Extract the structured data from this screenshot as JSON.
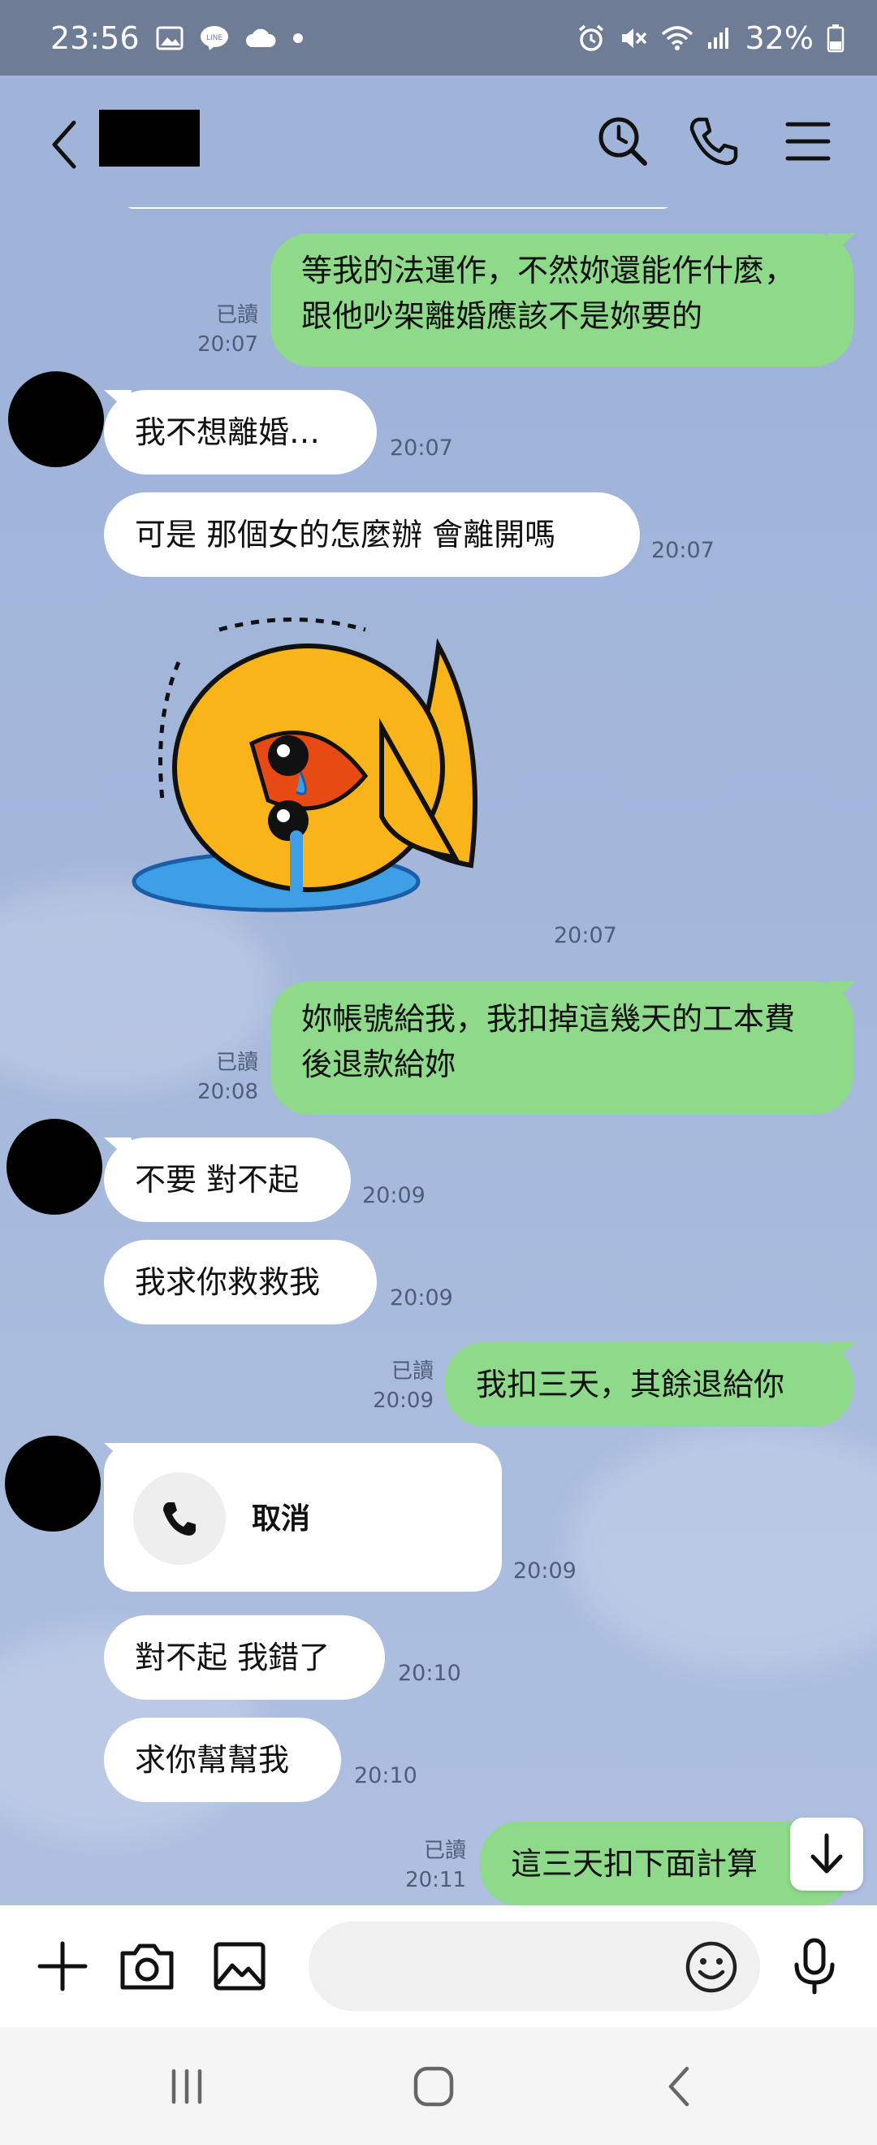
{
  "status_bar": {
    "time": "23:56",
    "battery": "32%"
  },
  "header": {
    "contact_name": "(redacted)"
  },
  "messages": {
    "m1": {
      "text": "等我的法運作，不然妳還能作什麼，跟他吵架離婚應該不是妳要的",
      "read": "已讀",
      "time": "20:07"
    },
    "m2": {
      "text": "我不想離婚…",
      "time": "20:07"
    },
    "m3": {
      "text": "可是 那個女的怎麼辦 會離開嗎",
      "time": "20:07"
    },
    "m4": {
      "sticker": "crying-yellow-fish-sticker",
      "time": "20:07"
    },
    "m5": {
      "text": "妳帳號給我，我扣掉這幾天的工本費後退款給妳",
      "read": "已讀",
      "time": "20:08"
    },
    "m6": {
      "text": "不要 對不起",
      "time": "20:09"
    },
    "m7": {
      "text": "我求你救救我",
      "time": "20:09"
    },
    "m8": {
      "text": "我扣三天，其餘退給你",
      "read": "已讀",
      "time": "20:09"
    },
    "m9": {
      "call_label": "取消",
      "time": "20:09"
    },
    "m10": {
      "text": "對不起 我錯了",
      "time": "20:10"
    },
    "m11": {
      "text": "求你幫幫我",
      "time": "20:10"
    },
    "m12": {
      "text": "這三天扣下面計算",
      "read": "已讀",
      "time": "20:11"
    }
  },
  "input": {
    "placeholder": "",
    "value": ""
  },
  "colors": {
    "outgoing_bubble": "#8ed98a",
    "incoming_bubble": "#ffffff",
    "chat_bg": "#9fb3d9"
  }
}
